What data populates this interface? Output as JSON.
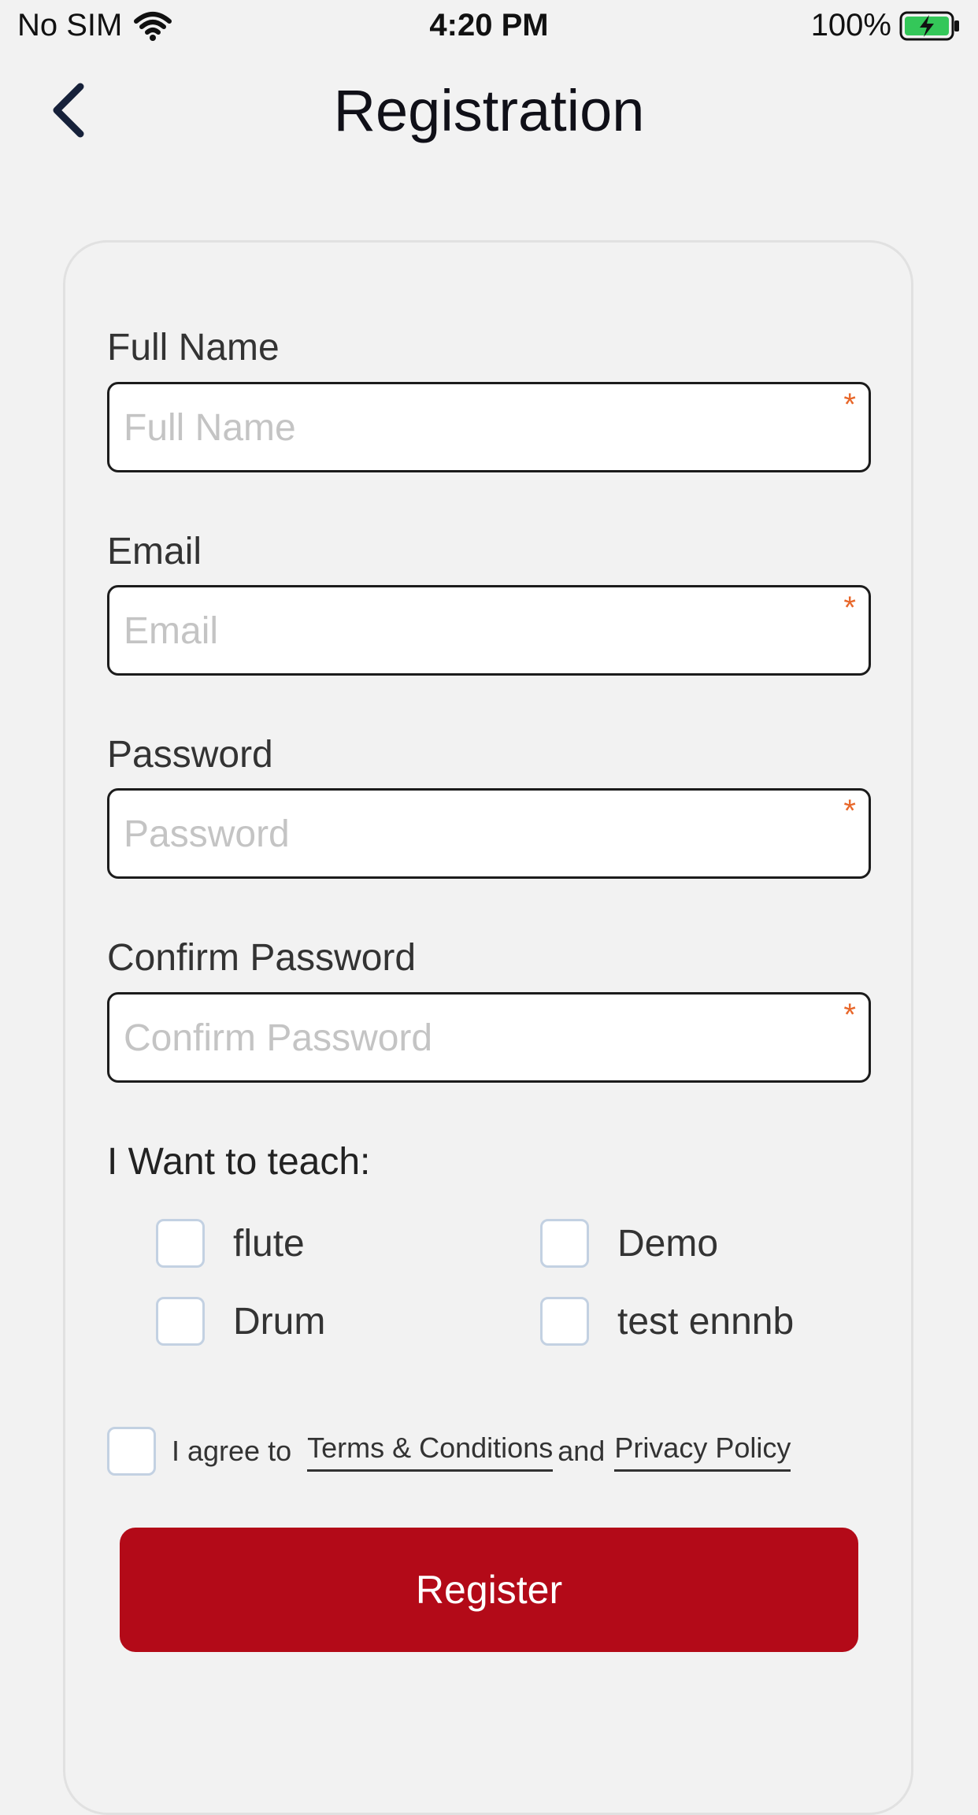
{
  "status_bar": {
    "carrier": "No SIM",
    "time": "4:20 PM",
    "battery": "100%"
  },
  "header": {
    "title": "Registration"
  },
  "form": {
    "full_name": {
      "label": "Full Name",
      "placeholder": "Full Name",
      "required_mark": "*"
    },
    "email": {
      "label": "Email",
      "placeholder": "Email",
      "required_mark": "*"
    },
    "password": {
      "label": "Password",
      "placeholder": "Password",
      "required_mark": "*"
    },
    "confirm_password": {
      "label": "Confirm Password",
      "placeholder": "Confirm Password",
      "required_mark": "*"
    },
    "teach": {
      "label": "I Want to teach:",
      "options": [
        "flute",
        "Demo",
        "Drum",
        "test ennnb"
      ]
    },
    "agree": {
      "prefix": "I agree to",
      "terms_link": "Terms & Conditions",
      "conjunction": "and",
      "privacy_link": "Privacy Policy"
    },
    "register_label": "Register"
  },
  "colors": {
    "accent": "#b30a18",
    "required_star": "#e8672a",
    "battery_fill": "#34c759"
  }
}
